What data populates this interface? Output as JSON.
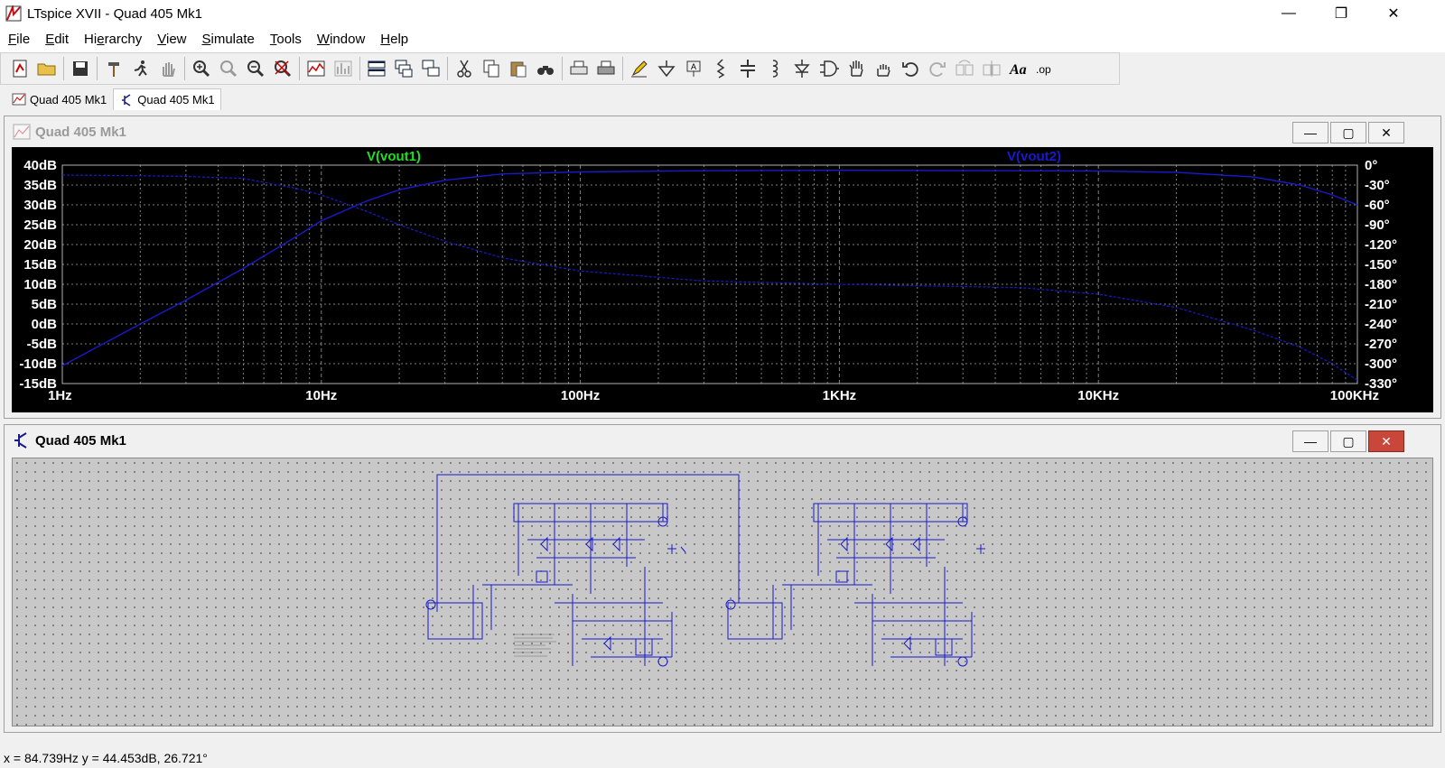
{
  "window": {
    "title": "LTspice XVII - Quad 405 Mk1",
    "minimize_glyph": "—",
    "restore_glyph": "❐",
    "close_glyph": "✕"
  },
  "menu": {
    "items": [
      {
        "key": "F",
        "rest": "ile"
      },
      {
        "key": "E",
        "rest": "dit"
      },
      {
        "pre": "Hi",
        "key": "e",
        "rest": "rarchy"
      },
      {
        "key": "V",
        "rest": "iew"
      },
      {
        "key": "S",
        "rest": "imulate"
      },
      {
        "key": "T",
        "rest": "ools"
      },
      {
        "key": "W",
        "rest": "indow"
      },
      {
        "key": "H",
        "rest": "elp"
      }
    ]
  },
  "tabs": [
    {
      "label": "Quad 405 Mk1",
      "icon": "waveform-icon",
      "active": false
    },
    {
      "label": "Quad 405 Mk1",
      "icon": "transistor-icon",
      "active": true
    }
  ],
  "plot_window": {
    "title": "Quad 405 Mk1",
    "trace1": "V(vout1)",
    "trace2": "V(vout2)",
    "trace1_color": "#22dd22",
    "trace2_color": "#1a1acc"
  },
  "schematic_window": {
    "title": "Quad 405 Mk1"
  },
  "mdi_buttons": {
    "minimize": "—",
    "maximize": "▢",
    "close": "✕"
  },
  "status": {
    "text": "x = 84.739Hz    y = 44.453dB, 26.721°"
  },
  "chart_data": {
    "type": "line",
    "xscale": "log",
    "xlim": [
      1,
      100000
    ],
    "xticks": [
      "1Hz",
      "10Hz",
      "100Hz",
      "1KHz",
      "10KHz",
      "100KHz"
    ],
    "ylim_left": [
      -15,
      40
    ],
    "yticks_left": [
      "40dB",
      "35dB",
      "30dB",
      "25dB",
      "20dB",
      "15dB",
      "10dB",
      "5dB",
      "0dB",
      "-5dB",
      "-10dB",
      "-15dB"
    ],
    "ylim_right": [
      -330,
      0
    ],
    "yticks_right": [
      "0°",
      "-30°",
      "-60°",
      "-90°",
      "-120°",
      "-150°",
      "-180°",
      "-210°",
      "-240°",
      "-270°",
      "-300°",
      "-330°"
    ],
    "grid": true,
    "series": [
      {
        "name": "V(vout1)",
        "x": [
          1,
          2,
          3,
          5,
          8,
          10,
          15,
          20,
          30,
          50,
          100,
          300,
          1000,
          5000,
          10000,
          20000,
          40000,
          60000,
          80000,
          100000
        ],
        "y": [
          -10.5,
          0,
          6,
          14,
          22,
          26,
          31,
          33.8,
          36.2,
          37.8,
          38.3,
          38.6,
          38.7,
          38.6,
          38.5,
          38.2,
          37,
          35,
          32.5,
          30
        ]
      },
      {
        "name": "V(vout2) phase",
        "axis": "right",
        "x": [
          1,
          2,
          3,
          5,
          8,
          10,
          15,
          20,
          30,
          50,
          100,
          300,
          1000,
          5000,
          10000,
          20000,
          40000,
          60000,
          80000,
          100000
        ],
        "y": [
          -15,
          -16,
          -17,
          -20,
          -35,
          -45,
          -70,
          -90,
          -115,
          -140,
          -160,
          -175,
          -180,
          -185,
          -195,
          -215,
          -250,
          -275,
          -300,
          -325
        ]
      }
    ]
  }
}
